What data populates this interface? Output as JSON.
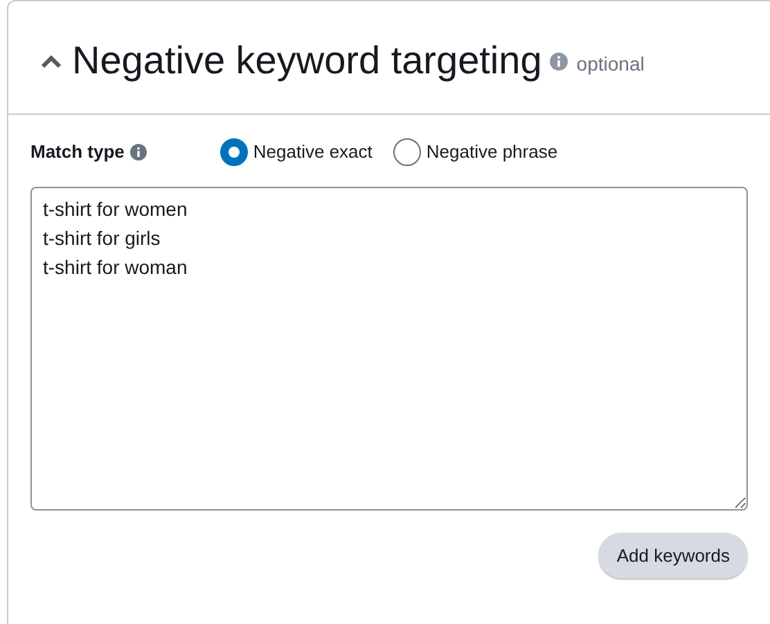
{
  "section": {
    "title": "Negative keyword targeting",
    "expanded": true,
    "tag": "optional"
  },
  "match_type": {
    "label": "Match type",
    "options": [
      {
        "label": "Negative exact",
        "selected": true
      },
      {
        "label": "Negative phrase",
        "selected": false
      }
    ]
  },
  "keywords": {
    "value": [
      "t-shirt for women",
      "t-shirt for girls",
      "t-shirt for woman"
    ]
  },
  "button": "Add keywords"
}
